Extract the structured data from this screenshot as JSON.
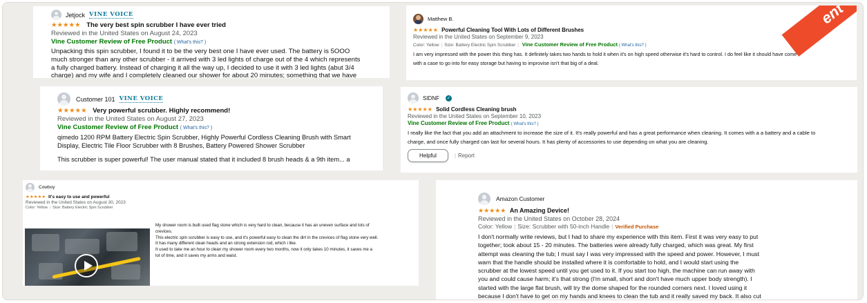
{
  "banner_text": "ent",
  "colors": {
    "star": "#f08a13",
    "vine_green": "#007600",
    "link_blue": "#2162a1",
    "verified_orange": "#c45500",
    "banner_red": "#ee4b2b"
  },
  "reviews": [
    {
      "author": "Jetjock",
      "badge": "VINE VOICE",
      "stars": "★★★★★",
      "title": "The very best spin scrubber I have ever tried",
      "date": "Reviewed in the United States on August 24, 2023",
      "vine": "Vine Customer Review of Free Product",
      "whats": "( What's this? )",
      "body": [
        "Unpacking this spin scrubber, I found it to be the very best one I have ever used. The battery is 5OOO",
        "much stronger than any other scrubber - it arrived with 3 led lights of charge out of the 4 which represents",
        "a fully charged battery. Instead of charging it all the way up, I decided to use it with 3 led lights (abut 3/4",
        "charge) and my wife and I completely cleaned our shower for about 20 minutes; something that we have"
      ]
    },
    {
      "author": "Matthew B.",
      "stars": "★★★★★",
      "title": "Powerful Cleaning Tool With Lots of Different Brushes",
      "date": "Reviewed in the United States on September 9, 2023",
      "color": "Color: Yellow",
      "size": "Size: Battery Electric Spin Scrubber",
      "vine": "Vine Customer Review of Free Product",
      "whats": "( What's this? )",
      "body": [
        "I am very impressed with the power this thing has. It definitely takes two hands to hold it when it's on high speed otherwise it's hard to control. I do feel like it should have come",
        "with a case to go into for easy storage but having to improvise isn't that big of a deal."
      ]
    },
    {
      "author": "Customer 101",
      "badge": "VINE VOICE",
      "stars": "★★★★★",
      "title": "Very powerful scrubber. Highly recommend!",
      "date": "Reviewed in the United States on August 27, 2023",
      "vine": "Vine Customer Review of Free Product",
      "whats": "( What's this? )",
      "body": [
        "qimedo 1200 RPM Battery Electric Spin Scrubber, Highly Powerful Cordless Cleaning Brush with Smart",
        "Display, Electric Tile Floor Scrubber with 8 Brushes, Battery Powered Shower Scrubber"
      ],
      "body2": "This scrubber is super powerful! The user manual stated that it included 8 brush heads & a 9th item... a"
    },
    {
      "author": "SIDNF",
      "stars": "★★★★★",
      "title": "Solid Cordless Cleaning brush",
      "date": "Reviewed in the United States on September 10, 2023",
      "vine": "Vine Customer Review of Free Product",
      "whats": "( What's this? )",
      "body": [
        "I really like the fact that you add an attachment to increase the size of it. It's really powerful and has a great performance when cleaning. It comes with a a battery and a cable to",
        "charge, and once fully charged can last for several hours. It has plenty of accessories to use depending on what you are cleaning."
      ],
      "helpful": "Helpful",
      "report": "Report"
    },
    {
      "author": "Cowboy",
      "stars": "★★★★★",
      "title": "It's easy to use and powerful",
      "date": "Reviewed in the United States on August 30, 2023",
      "color": "Color: Yellow",
      "size": "Size: Battery Electric Spin Scrubber",
      "body": [
        "My shower room is built used flag stone which is very hard to clean, because it has an uneven surface and lots of",
        "crevices.",
        "This electric spin scrubber is easy to use, and it's powerful easy to clean the dirt in the crevices of flag stone very well.",
        "It has many different clean heads and an strong extension rod, which i like.",
        "It used to take me an hour to clean my shower room every two months, now it only takes 10 minutes, it saves me a",
        "lot of time, and it saves my arms and waist."
      ]
    },
    {
      "author": "Amazon Customer",
      "stars": "★★★★★",
      "title": "An Amazing Device!",
      "date": "Reviewed in the United States on October 28, 2024",
      "color": "Color: Yellow",
      "size": "Size: Scrubber with 50-inch Handle",
      "verified": "Verified Purchase",
      "body": [
        "I don't normally write reviews, but I had to share my experience with this item. First it was very easy to put",
        "together; took about 15 - 20 minutes. The batteries were already fully charged, which was great. My first",
        "attempt was cleaning the tub; I must say I was very impressed with the speed and power. However, I must",
        "warn that the handle should be installed where it is comfortable to hold, and I would start using the",
        "scrubber at the lowest speed until you get used to it. If you start too high, the machine can run away with",
        "you and could cause harm; it's that strong (I'm small, short and don't have much upper body strength). I",
        "started with the large flat brush, will try the dome shaped for the rounded corners next. I loved using it",
        "because I don't have to get on my hands and knees to clean the tub and it really saved my back. It also cut"
      ]
    }
  ]
}
